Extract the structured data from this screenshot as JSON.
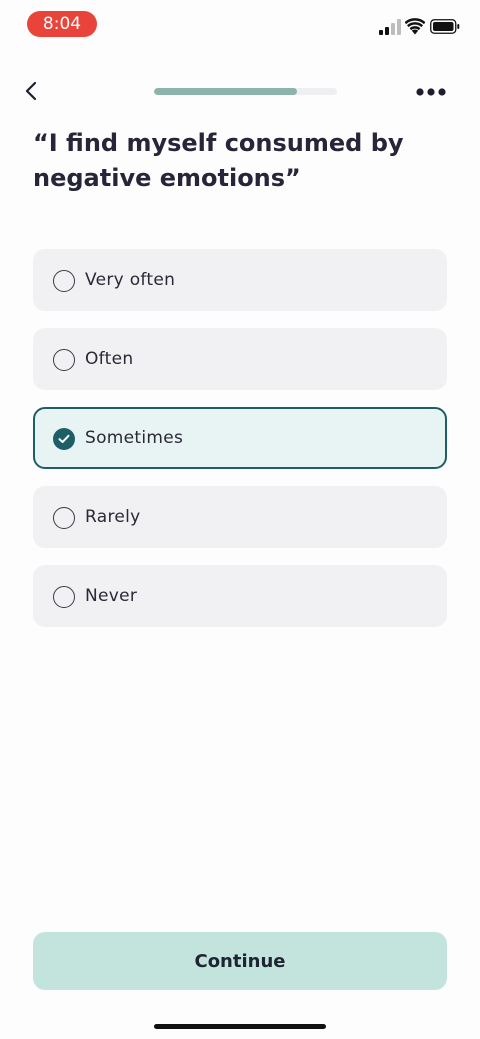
{
  "status_bar": {
    "time": "8:04"
  },
  "nav": {
    "progress_percent": 78
  },
  "question": {
    "text": "“I find myself consumed by negative emotions”"
  },
  "options": [
    {
      "label": "Very often",
      "selected": false
    },
    {
      "label": "Often",
      "selected": false
    },
    {
      "label": "Sometimes",
      "selected": true
    },
    {
      "label": "Rarely",
      "selected": false
    },
    {
      "label": "Never",
      "selected": false
    }
  ],
  "continue": {
    "label": "Continue"
  },
  "colors": {
    "accent": "#1E5E66",
    "progress": "#8DB3AD",
    "continue_bg": "#C2E4DD",
    "time_pill": "#E8443A"
  },
  "icons": {
    "back": "chevron-left-icon",
    "more": "more-horizontal-icon",
    "check": "check-icon"
  }
}
